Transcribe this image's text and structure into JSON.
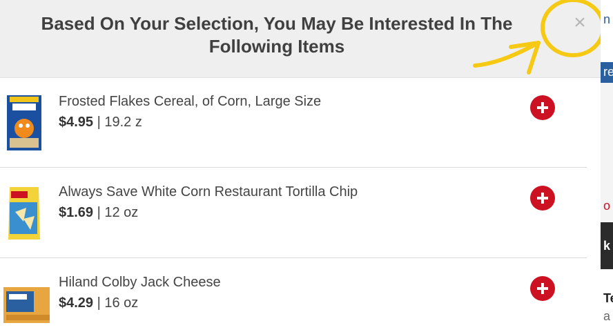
{
  "modal": {
    "title": "Based On Your Selection, You May Be Interested In The Following Items",
    "close_label": "×"
  },
  "items": [
    {
      "name": "Frosted Flakes Cereal, of Corn, Large Size",
      "price": "$4.95",
      "separator": " | ",
      "size": "19.2 z",
      "thumb_icon": "cereal-box"
    },
    {
      "name": "Always Save White Corn Restaurant Tortilla Chip",
      "price": "$1.69",
      "separator": " | ",
      "size": "12 oz",
      "thumb_icon": "chip-bag"
    },
    {
      "name": "Hiland Colby Jack Cheese",
      "price": "$4.29",
      "separator": " | ",
      "size": "16 oz",
      "thumb_icon": "cheese-block"
    }
  ],
  "background_page": {
    "fragments": [
      "n",
      "re",
      "o",
      "k",
      "Te",
      "a"
    ]
  },
  "colors": {
    "header_bg": "#efefef",
    "add_button": "#cc1122",
    "annotation": "#f6c915"
  }
}
